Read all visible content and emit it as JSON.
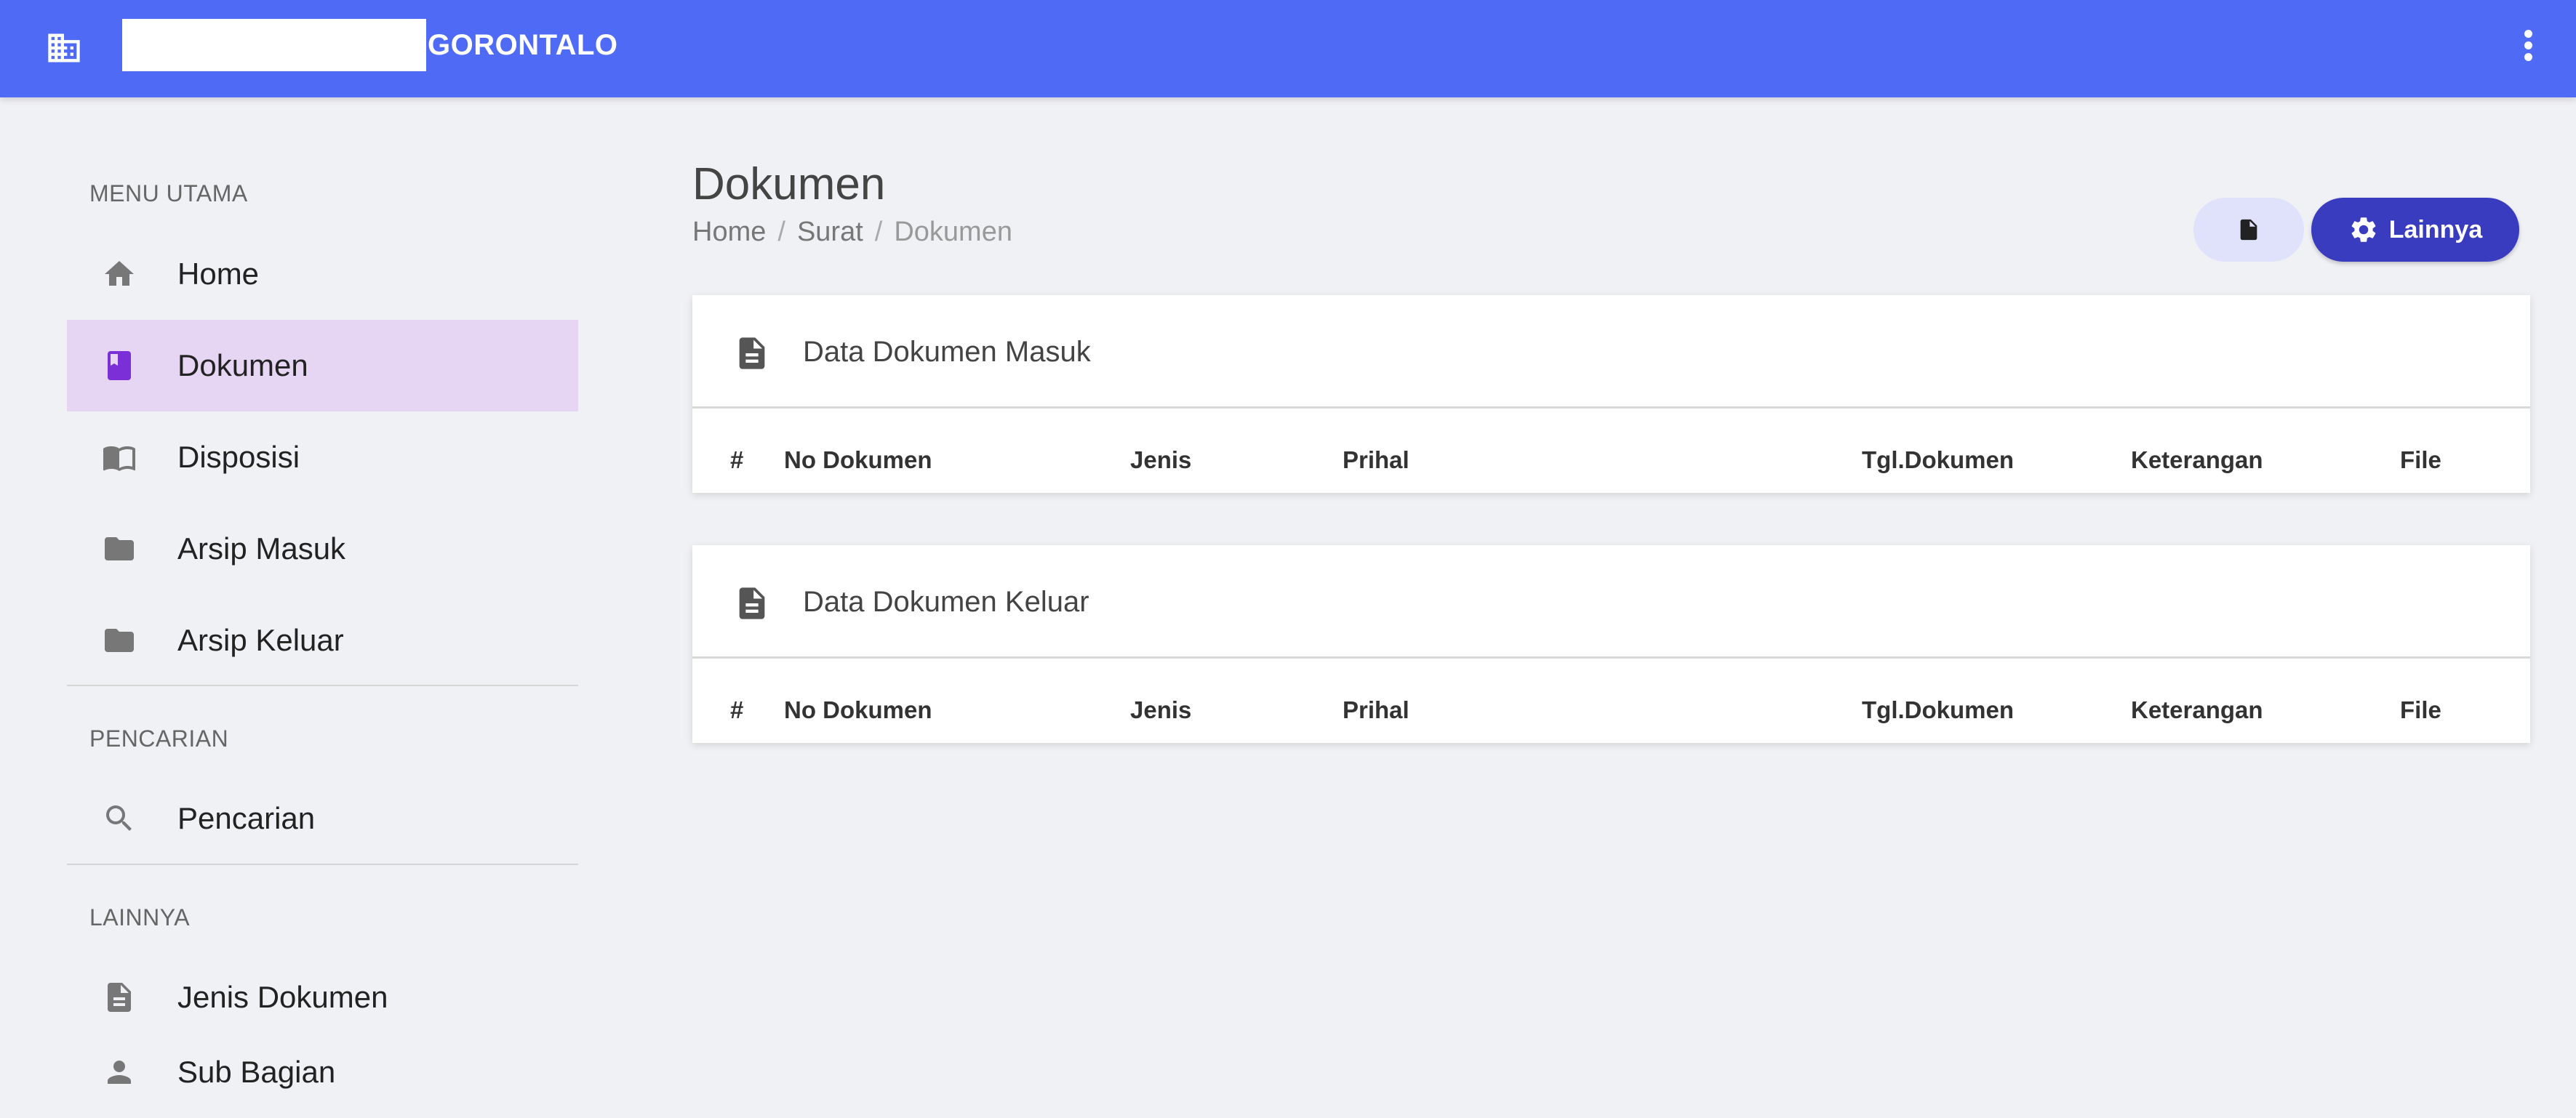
{
  "topbar": {
    "brand_text": "GORONTALO",
    "brand_icon": "building-icon",
    "menu_icon": "more-vert-icon",
    "color": "#4f6bf5"
  },
  "sidebar": {
    "sections": [
      {
        "title": "MENU UTAMA",
        "items": [
          {
            "label": "Home",
            "icon": "home-icon"
          },
          {
            "label": "Dokumen",
            "icon": "book-icon",
            "active": true
          },
          {
            "label": "Disposisi",
            "icon": "open-book-icon"
          },
          {
            "label": "Arsip Masuk",
            "icon": "folder-icon"
          },
          {
            "label": "Arsip Keluar",
            "icon": "folder-icon"
          }
        ]
      },
      {
        "title": "PENCARIAN",
        "items": [
          {
            "label": "Pencarian",
            "icon": "search-icon"
          }
        ]
      },
      {
        "title": "LAINNYA",
        "items": [
          {
            "label": "Jenis Dokumen",
            "icon": "document-icon"
          },
          {
            "label": "Sub Bagian",
            "icon": "person-icon"
          }
        ]
      }
    ],
    "active_color": "#e6d6f3",
    "active_icon_color": "#7b2fd6"
  },
  "page": {
    "title": "Dokumen",
    "breadcrumb": [
      "Home",
      "Surat",
      "Dokumen"
    ],
    "breadcrumb_separator": "/"
  },
  "actions": {
    "doc_button_icon": "file-icon",
    "lainnya_label": "Lainnya",
    "lainnya_icon": "gear-icon",
    "lainnya_color": "#3a3cc0"
  },
  "cards": [
    {
      "title": "Data Dokumen Masuk",
      "icon": "document-icon",
      "columns": [
        "#",
        "No Dokumen",
        "Jenis",
        "Prihal",
        "Tgl.Dokumen",
        "Keterangan",
        "File"
      ]
    },
    {
      "title": "Data Dokumen Keluar",
      "icon": "document-icon",
      "columns": [
        "#",
        "No Dokumen",
        "Jenis",
        "Prihal",
        "Tgl.Dokumen",
        "Keterangan",
        "File"
      ]
    }
  ]
}
